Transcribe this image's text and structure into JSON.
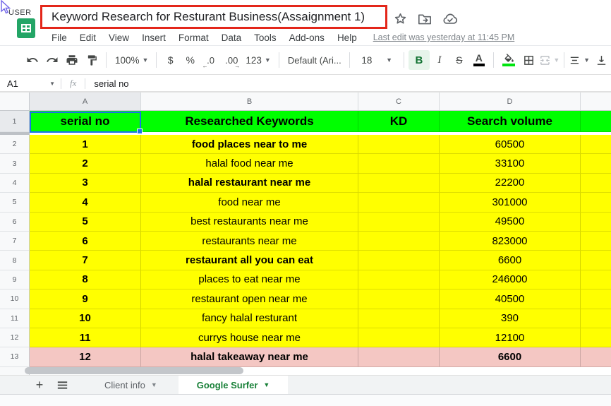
{
  "window": {
    "user_label": "USER"
  },
  "titlebar": {
    "title": "Keyword Research for Resturant Business(Assaignment 1)",
    "icons": [
      "star-icon",
      "move-to-folder-icon",
      "cloud-saved-icon"
    ]
  },
  "menus": [
    "File",
    "Edit",
    "View",
    "Insert",
    "Format",
    "Data",
    "Tools",
    "Add-ons",
    "Help"
  ],
  "last_edit": "Last edit was yesterday at 11:45 PM",
  "toolbar": {
    "zoom": "100%",
    "currency": "$",
    "percent": "%",
    "dec_less": ".0",
    "dec_more": ".00",
    "number_format": "123",
    "font": "Default (Ari...",
    "font_size": "18",
    "bold": "B",
    "italic": "I",
    "strike": "S",
    "text_color": "A",
    "fill_underline_color": "#00e510"
  },
  "formula_bar": {
    "cell_ref": "A1",
    "fx": "fx",
    "value": "serial no"
  },
  "sheet": {
    "column_letters": [
      "A",
      "B",
      "C",
      "D",
      ""
    ],
    "header_row": {
      "number": "1",
      "serial": "serial no",
      "keywords": "Researched Keywords",
      "kd": "KD",
      "volume": "Search volume"
    },
    "colors": {
      "header_bg": "#00ff00",
      "row_bg": "#ffff00",
      "last_row_bg": "#f4c7c3",
      "selection": "#1a73e8"
    },
    "rows": [
      {
        "number": "2",
        "serial": "1",
        "keyword": "food places near to me",
        "kd": "",
        "volume": "60500",
        "kw_bold": true,
        "vol_bold": false,
        "pink": false
      },
      {
        "number": "3",
        "serial": "2",
        "keyword": "halal food near me",
        "kd": "",
        "volume": "33100",
        "kw_bold": false,
        "vol_bold": false,
        "pink": false
      },
      {
        "number": "4",
        "serial": "3",
        "keyword": "halal restaurant near me",
        "kd": "",
        "volume": "22200",
        "kw_bold": true,
        "vol_bold": false,
        "pink": false
      },
      {
        "number": "5",
        "serial": "4",
        "keyword": "food near me",
        "kd": "",
        "volume": "301000",
        "kw_bold": false,
        "vol_bold": false,
        "pink": false
      },
      {
        "number": "6",
        "serial": "5",
        "keyword": "best restaurants near me",
        "kd": "",
        "volume": "49500",
        "kw_bold": false,
        "vol_bold": false,
        "pink": false
      },
      {
        "number": "7",
        "serial": "6",
        "keyword": "restaurants near me",
        "kd": "",
        "volume": "823000",
        "kw_bold": false,
        "vol_bold": false,
        "pink": false
      },
      {
        "number": "8",
        "serial": "7",
        "keyword": "restaurant all you can eat",
        "kd": "",
        "volume": "6600",
        "kw_bold": true,
        "vol_bold": false,
        "pink": false
      },
      {
        "number": "9",
        "serial": "8",
        "keyword": "places to eat near me",
        "kd": "",
        "volume": "246000",
        "kw_bold": false,
        "vol_bold": false,
        "pink": false
      },
      {
        "number": "10",
        "serial": "9",
        "keyword": "restaurant open near me",
        "kd": "",
        "volume": "40500",
        "kw_bold": false,
        "vol_bold": false,
        "pink": false
      },
      {
        "number": "11",
        "serial": "10",
        "keyword": "fancy halal resturant",
        "kd": "",
        "volume": "390",
        "kw_bold": false,
        "vol_bold": false,
        "pink": false
      },
      {
        "number": "12",
        "serial": "11",
        "keyword": "currys house near me",
        "kd": "",
        "volume": "12100",
        "kw_bold": false,
        "vol_bold": false,
        "pink": false
      },
      {
        "number": "13",
        "serial": "12",
        "keyword": "halal takeaway near me",
        "kd": "",
        "volume": "6600",
        "kw_bold": true,
        "vol_bold": true,
        "pink": true
      }
    ]
  },
  "tabs": {
    "client": "Client info",
    "active": "Google Surfer"
  }
}
